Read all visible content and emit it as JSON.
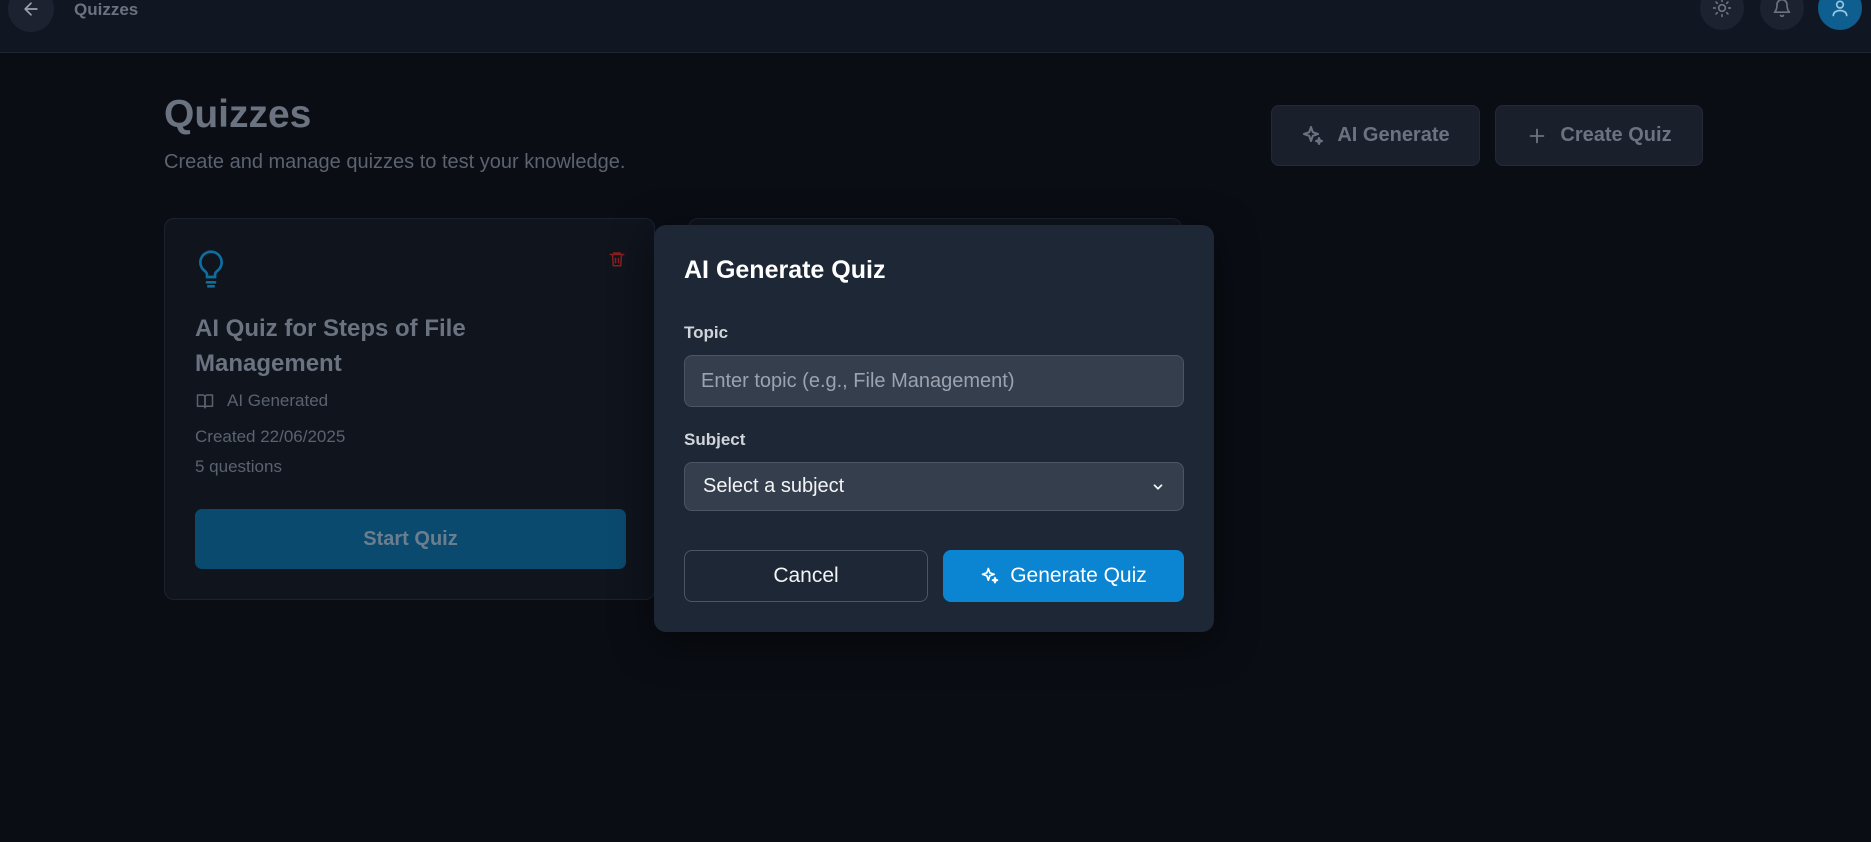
{
  "topbar": {
    "breadcrumb": "Quizzes",
    "back_icon": "arrow-left-icon",
    "theme_icon": "sun-icon",
    "notifications_icon": "bell-icon",
    "avatar_icon": "user-icon"
  },
  "header": {
    "title": "Quizzes",
    "subtitle": "Create and manage quizzes to test your knowledge.",
    "ai_generate_label": "AI Generate",
    "create_quiz_label": "Create Quiz"
  },
  "quizzes": [
    {
      "title": "AI Quiz for Steps of File Management",
      "source": "AI Generated",
      "created": "Created 22/06/2025",
      "question_count": "5 questions",
      "start_label": "Start Quiz"
    }
  ],
  "modal": {
    "title": "AI Generate Quiz",
    "topic_label": "Topic",
    "topic_value": "",
    "topic_placeholder": "Enter topic (e.g., File Management)",
    "subject_label": "Subject",
    "subject_selected": "Select a subject",
    "cancel_label": "Cancel",
    "generate_label": "Generate Quiz"
  },
  "colors": {
    "accent": "#0b84d1",
    "danger": "#b91c1c",
    "background": "#0a0d14",
    "modal_bg": "#1e2735"
  }
}
